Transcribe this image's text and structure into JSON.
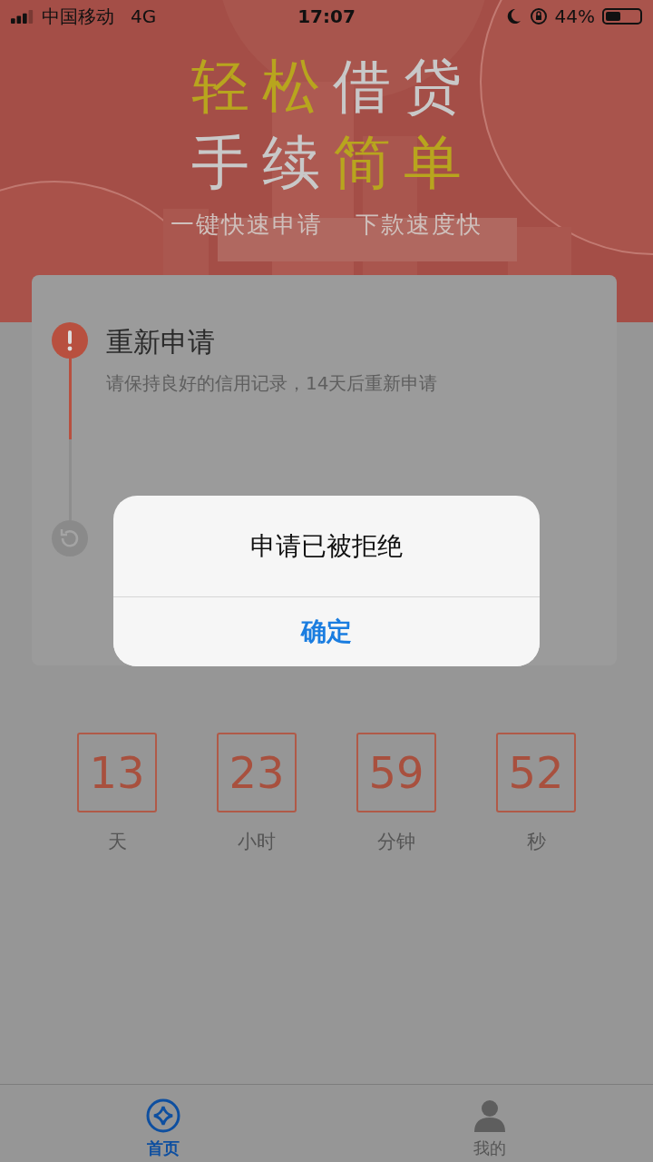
{
  "status_bar": {
    "carrier": "中国移动",
    "network": "4G",
    "time": "17:07",
    "battery_text": "44%",
    "battery": {
      "level": 0.44
    }
  },
  "banner": {
    "headline": [
      [
        {
          "text": "轻松",
          "highlight": true
        },
        {
          "text": "借贷",
          "highlight": false
        }
      ],
      [
        {
          "text": "手续",
          "highlight": false
        },
        {
          "text": "简单",
          "highlight": true
        }
      ]
    ],
    "slogans": [
      "一键快速申请",
      "下款速度快"
    ]
  },
  "steps": [
    {
      "kind": "alert",
      "title": "重新申请",
      "description": "请保持良好的信用记录，14天后重新申请"
    },
    {
      "kind": "pending"
    }
  ],
  "countdown": [
    {
      "value": "13",
      "unit": "天"
    },
    {
      "value": "23",
      "unit": "小时"
    },
    {
      "value": "59",
      "unit": "分钟"
    },
    {
      "value": "52",
      "unit": "秒"
    }
  ],
  "tabs": [
    {
      "label": "首页",
      "kind": "home",
      "selected": true
    },
    {
      "label": "我的",
      "kind": "profile",
      "selected": false
    }
  ],
  "dialog": {
    "message": "申请已被拒绝",
    "button": "确定"
  }
}
